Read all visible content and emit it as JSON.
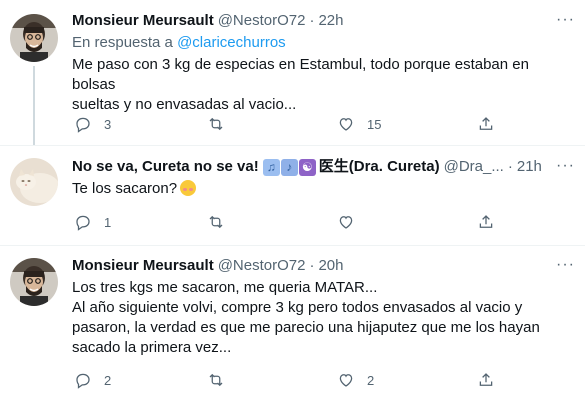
{
  "tweets": [
    {
      "author": {
        "name": "Monsieur Meursault",
        "handle": "@NestorO72"
      },
      "time": "22h",
      "reply_to": {
        "prefix": "En respuesta a",
        "handle": "@claricechurros"
      },
      "text": [
        "Me paso con 3 kg de especias en Estambul, todo porque estaban en bolsas",
        "sueltas y no envasadas al vacio..."
      ],
      "counts": {
        "replies": "3",
        "retweets": "",
        "likes": "15"
      }
    },
    {
      "author": {
        "name": "No se va, Cureta no se va!",
        "handle": "@Dra_...",
        "name_suffix": "医生(Dra. Cureta)"
      },
      "time": "21h",
      "text": [
        "Te los sacaron?"
      ],
      "counts": {
        "replies": "1",
        "retweets": "",
        "likes": ""
      }
    },
    {
      "author": {
        "name": "Monsieur Meursault",
        "handle": "@NestorO72"
      },
      "time": "20h",
      "text": [
        "Los tres kgs me sacaron, me queria MATAR...",
        "Al año siguiente volvi, compre 3 kg pero todos envasados al vacio y",
        "pasaron, la verdad es que me parecio una hijaputez que me los hayan",
        "sacado la primera vez..."
      ],
      "counts": {
        "replies": "2",
        "retweets": "",
        "likes": "2"
      }
    }
  ],
  "ui": {
    "dot": "·",
    "more": "···"
  },
  "icons": {
    "reply": "speech-bubble-icon",
    "retweet": "retweet-arrows-icon",
    "like": "heart-icon",
    "share": "share-upload-icon"
  },
  "colors": {
    "link": "#1d9bf0",
    "secondary_text": "#536471",
    "primary_text": "#0f1419"
  }
}
